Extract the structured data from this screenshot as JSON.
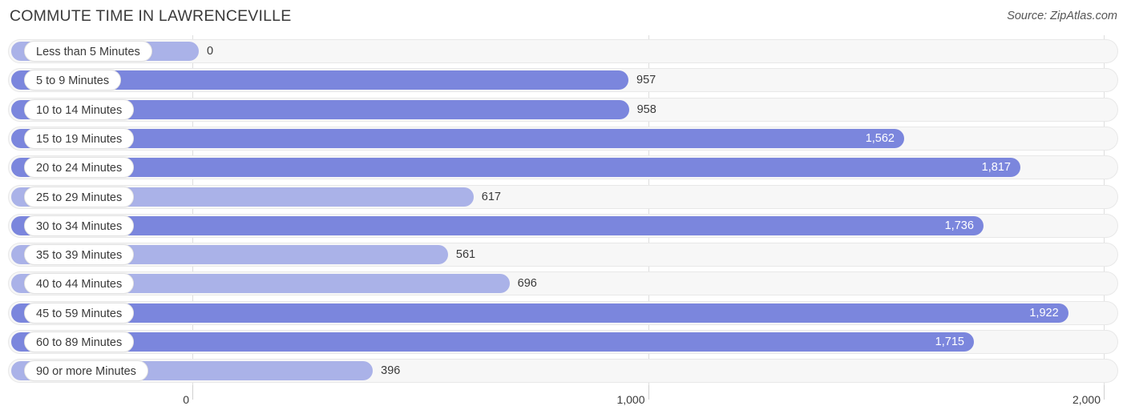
{
  "header": {
    "title": "COMMUTE TIME IN LAWRENCEVILLE",
    "source": "Source: ZipAtlas.com"
  },
  "colors": {
    "bar_dark": "#7b86dd",
    "bar_light": "#aab2e8",
    "track": "#f7f7f7",
    "gridline": "#dedede",
    "text": "#3a3a3a"
  },
  "chart_data": {
    "type": "bar",
    "orientation": "horizontal",
    "title": "COMMUTE TIME IN LAWRENCEVILLE",
    "xlabel": "",
    "ylabel": "",
    "xlim": [
      0,
      2000
    ],
    "grid": true,
    "legend": "none",
    "axis_ticks": [
      "0",
      "1,000",
      "2,000"
    ],
    "axis_tick_values": [
      0,
      1000,
      2000
    ],
    "categories": [
      "Less than 5 Minutes",
      "5 to 9 Minutes",
      "10 to 14 Minutes",
      "15 to 19 Minutes",
      "20 to 24 Minutes",
      "25 to 29 Minutes",
      "30 to 34 Minutes",
      "35 to 39 Minutes",
      "40 to 44 Minutes",
      "45 to 59 Minutes",
      "60 to 89 Minutes",
      "90 or more Minutes"
    ],
    "values": [
      0,
      957,
      958,
      1562,
      1817,
      617,
      1736,
      561,
      696,
      1922,
      1715,
      396
    ],
    "value_labels": [
      "0",
      "957",
      "958",
      "1,562",
      "1,817",
      "617",
      "1,736",
      "561",
      "696",
      "1,922",
      "1,715",
      "396"
    ],
    "bars": [
      {
        "label": "Less than 5 Minutes",
        "value": 0,
        "value_label": "0",
        "shade": "light",
        "label_position": "outside"
      },
      {
        "label": "5 to 9 Minutes",
        "value": 957,
        "value_label": "957",
        "shade": "dark",
        "label_position": "outside"
      },
      {
        "label": "10 to 14 Minutes",
        "value": 958,
        "value_label": "958",
        "shade": "dark",
        "label_position": "outside"
      },
      {
        "label": "15 to 19 Minutes",
        "value": 1562,
        "value_label": "1,562",
        "shade": "dark",
        "label_position": "inside"
      },
      {
        "label": "20 to 24 Minutes",
        "value": 1817,
        "value_label": "1,817",
        "shade": "dark",
        "label_position": "inside"
      },
      {
        "label": "25 to 29 Minutes",
        "value": 617,
        "value_label": "617",
        "shade": "light",
        "label_position": "outside"
      },
      {
        "label": "30 to 34 Minutes",
        "value": 1736,
        "value_label": "1,736",
        "shade": "dark",
        "label_position": "inside"
      },
      {
        "label": "35 to 39 Minutes",
        "value": 561,
        "value_label": "561",
        "shade": "light",
        "label_position": "outside"
      },
      {
        "label": "40 to 44 Minutes",
        "value": 696,
        "value_label": "696",
        "shade": "light",
        "label_position": "outside"
      },
      {
        "label": "45 to 59 Minutes",
        "value": 1922,
        "value_label": "1,922",
        "shade": "dark",
        "label_position": "inside"
      },
      {
        "label": "60 to 89 Minutes",
        "value": 1715,
        "value_label": "1,715",
        "shade": "dark",
        "label_position": "inside"
      },
      {
        "label": "90 or more Minutes",
        "value": 396,
        "value_label": "396",
        "shade": "light",
        "label_position": "outside"
      }
    ]
  }
}
